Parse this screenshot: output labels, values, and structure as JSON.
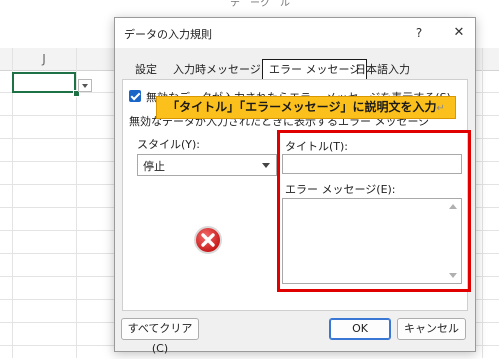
{
  "spreadsheet": {
    "column_header": "J",
    "top_fragment": "テ゛ーク゛ル"
  },
  "dialog": {
    "title": "データの入力規則",
    "help_label": "?",
    "close_label": "✕",
    "tabs": [
      {
        "label": "設定",
        "active": false
      },
      {
        "label": "入力時メッセージ",
        "active": false
      },
      {
        "label": "エラー メッセージ",
        "active": true
      },
      {
        "label": "日本語入力",
        "active": false
      }
    ],
    "show_error_checkbox": {
      "label": "無効なデータが入力されたらエラー メッセージを表示する(S)",
      "checked": true
    },
    "section_label": "無効なデータが入力されたときに表示するエラー メッセージ",
    "style_label": "スタイル(Y):",
    "style_value": "停止",
    "title_label": "タイトル(T):",
    "title_value": "",
    "message_label": "エラー メッセージ(E):",
    "message_value": "",
    "clear_all_label": "すべてクリア(C)",
    "ok_label": "OK",
    "cancel_label": "キャンセル"
  },
  "annotation": {
    "callout_text": "「タイトル」「エラーメッセージ」に説明文を入力",
    "callout_mark": "↵",
    "callout_color": "#fcc01d",
    "highlight_color": "#e00000"
  },
  "icons": {
    "error": "error-stop-icon"
  }
}
